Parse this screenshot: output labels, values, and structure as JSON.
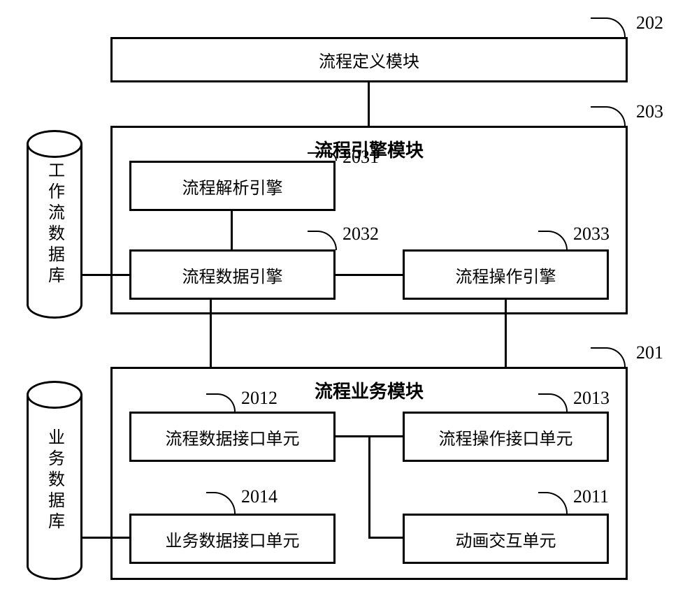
{
  "labels": {
    "module_202": "202",
    "module_203": "203",
    "module_201": "201",
    "sub_2031": "2031",
    "sub_2032": "2032",
    "sub_2033": "2033",
    "sub_2011": "2011",
    "sub_2012": "2012",
    "sub_2013": "2013",
    "sub_2014": "2014"
  },
  "boxes": {
    "top": "流程定义模块",
    "engine_title": "流程引擎模块",
    "engine_parse": "流程解析引擎",
    "engine_data": "流程数据引擎",
    "engine_op": "流程操作引擎",
    "business_title": "流程业务模块",
    "biz_data_if": "流程数据接口单元",
    "biz_op_if": "流程操作接口单元",
    "biz_bizdata_if": "业务数据接口单元",
    "biz_anim": "动画交互单元"
  },
  "cylinders": {
    "workflow_db": "工作流数据库",
    "business_db": "业务数据库"
  }
}
